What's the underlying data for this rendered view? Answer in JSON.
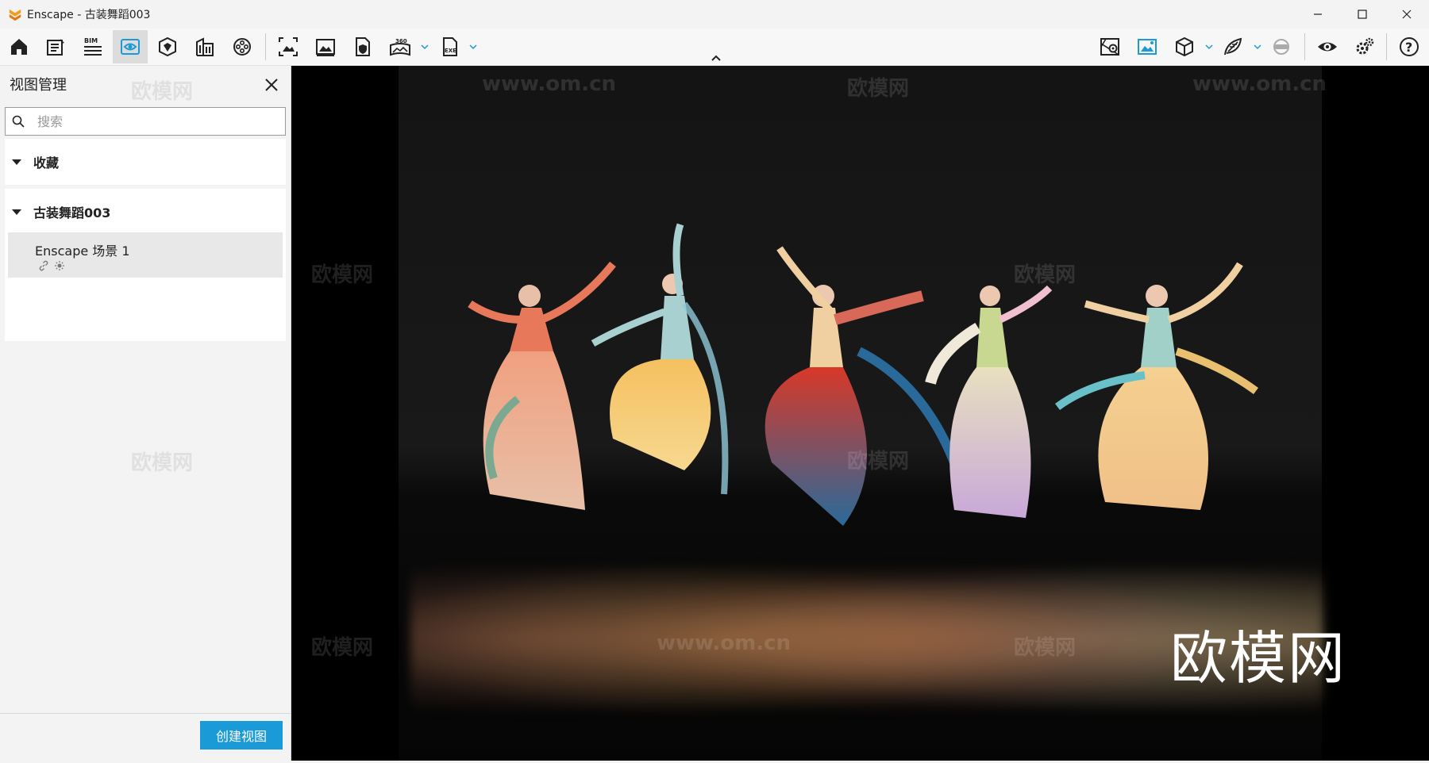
{
  "window": {
    "title": "Enscape - 古装舞蹈003",
    "controls": [
      "minimize",
      "maximize",
      "close"
    ]
  },
  "toolbar": {
    "left_buttons": [
      {
        "name": "home",
        "icon": "home-icon"
      },
      {
        "name": "notes",
        "icon": "notes-icon"
      },
      {
        "name": "bim",
        "icon": "bim-icon",
        "label": "BIM"
      },
      {
        "name": "view-management",
        "icon": "eye-screen-icon",
        "active": true
      },
      {
        "name": "asset-library",
        "icon": "asset-library-icon"
      },
      {
        "name": "material-editor",
        "icon": "building-icon"
      },
      {
        "name": "video-editor",
        "icon": "film-reel-icon"
      },
      {
        "name": "screenshot",
        "icon": "capture-icon"
      },
      {
        "name": "batch-render",
        "icon": "image-icon"
      },
      {
        "name": "export-pano",
        "icon": "file-shield-icon"
      },
      {
        "name": "panorama-360",
        "icon": "panorama-360-icon",
        "label": "360"
      },
      {
        "name": "export-exe",
        "icon": "exe-file-icon",
        "label": "EXE"
      }
    ],
    "right_buttons": [
      {
        "name": "map",
        "icon": "map-pin-icon"
      },
      {
        "name": "rendered-view",
        "icon": "landscape-icon",
        "active": true
      },
      {
        "name": "cube-view",
        "icon": "cube-icon"
      },
      {
        "name": "light-view",
        "icon": "leaf-icon"
      },
      {
        "name": "vr-headset",
        "icon": "vr-headset-icon"
      },
      {
        "name": "visual-settings",
        "icon": "eye-icon"
      },
      {
        "name": "general-settings",
        "icon": "gears-icon"
      },
      {
        "name": "help",
        "icon": "help-icon"
      }
    ],
    "accent": "#1a9ad6"
  },
  "panel": {
    "title": "视图管理",
    "search_placeholder": "搜索",
    "favorites_label": "收藏",
    "project_label": "古装舞蹈003",
    "view_item": "Enscape 场景 1",
    "create_button": "创建视图"
  },
  "viewport": {
    "brand_overlay": "欧模网",
    "watermarks": [
      "欧模网",
      "www.om.cn"
    ]
  }
}
